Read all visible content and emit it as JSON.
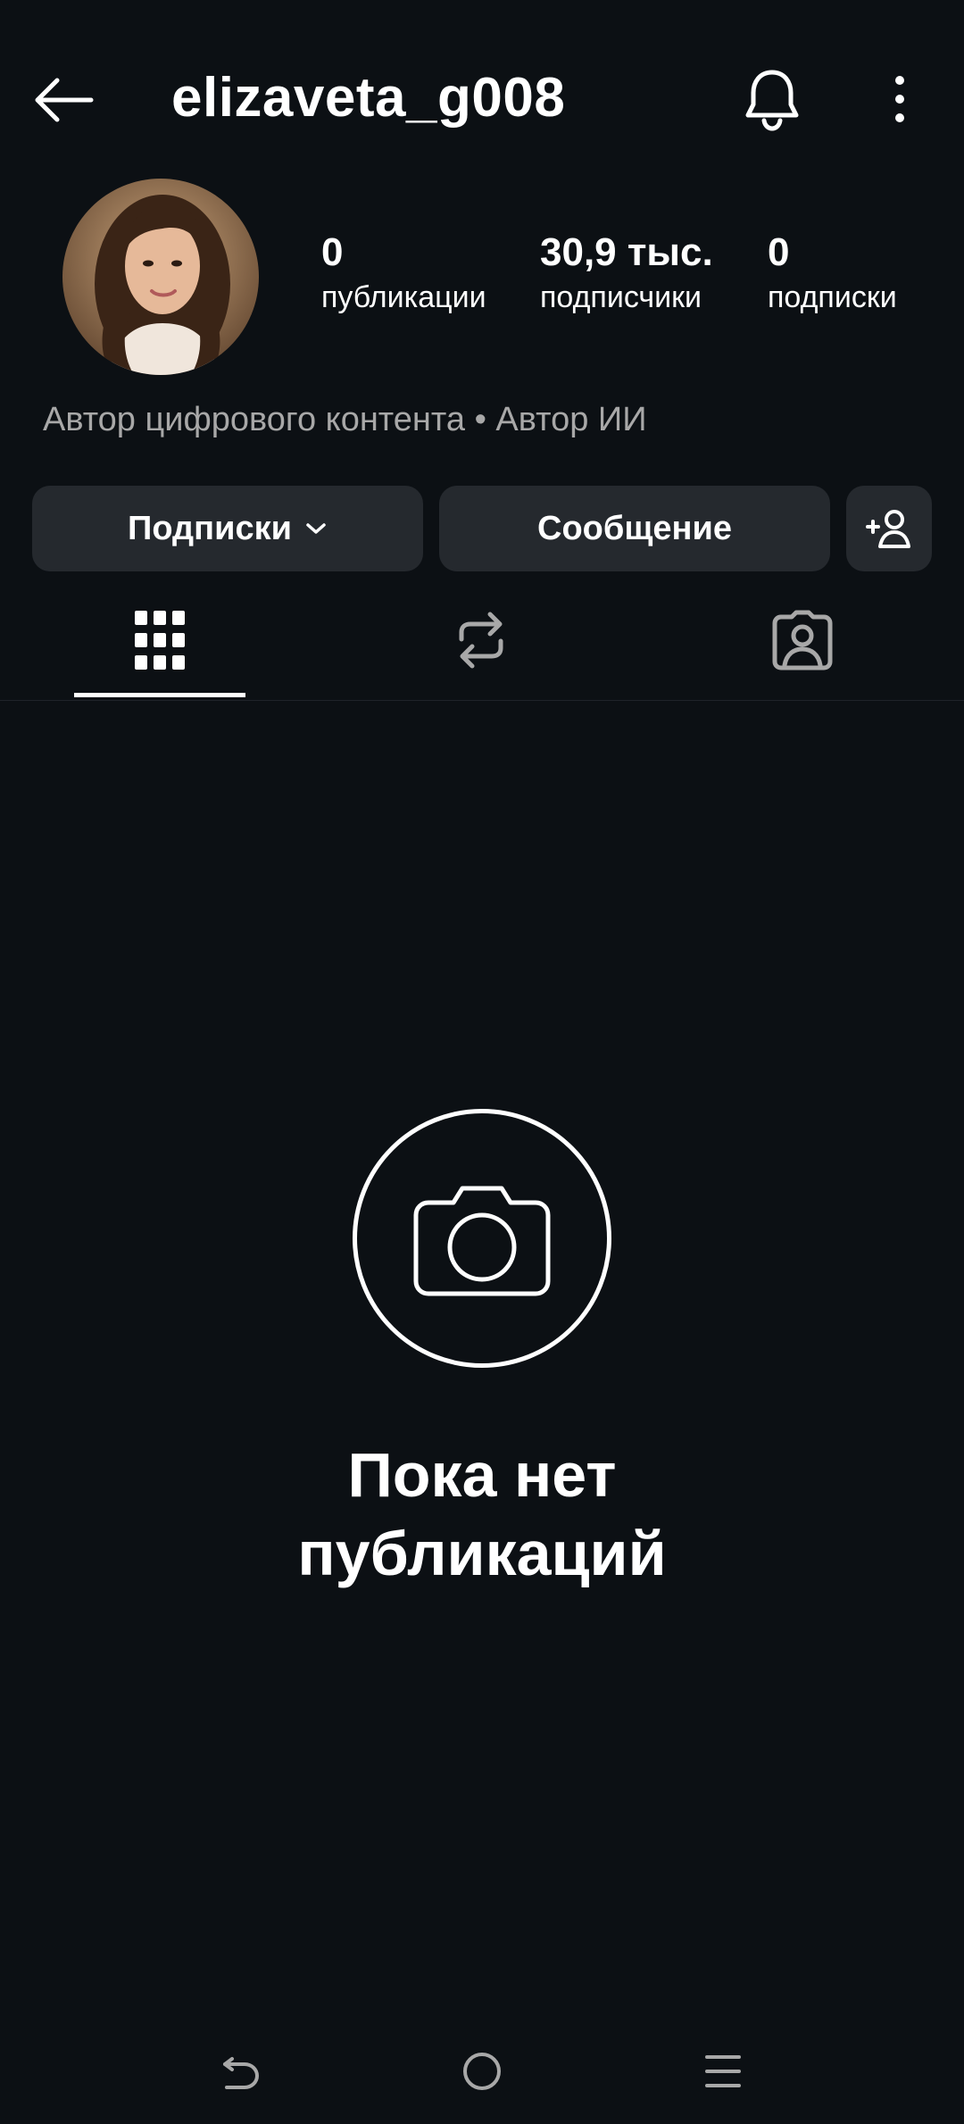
{
  "header": {
    "username": "elizaveta_g008",
    "back_icon": "arrow-left-icon",
    "notifications_icon": "bell-icon",
    "more_icon": "more-vertical-icon"
  },
  "profile": {
    "avatar_icon": "profile-avatar",
    "stats": {
      "posts": {
        "value": "0",
        "label": "публикации"
      },
      "followers": {
        "value": "30,9 тыс.",
        "label": "подписчики"
      },
      "following": {
        "value": "0",
        "label": "подписки"
      }
    },
    "bio": "Автор цифрового контента • Автор ИИ"
  },
  "actions": {
    "following_label": "Подписки",
    "message_label": "Сообщение",
    "add_user_icon": "add-user-icon"
  },
  "tabs": [
    {
      "name": "grid",
      "icon": "grid-icon",
      "active": true
    },
    {
      "name": "reposts",
      "icon": "repost-icon",
      "active": false
    },
    {
      "name": "tagged",
      "icon": "tagged-person-icon",
      "active": false
    }
  ],
  "empty_state": {
    "icon": "camera-icon",
    "title": "Пока нет\nпубликаций"
  },
  "system_nav": {
    "back_icon": "system-back-icon",
    "home_icon": "system-home-icon",
    "recents_icon": "system-recents-icon"
  },
  "colors": {
    "background": "#0c1014",
    "button_bg": "#25292e",
    "muted_text": "#a8a8a8",
    "text": "#ffffff"
  }
}
